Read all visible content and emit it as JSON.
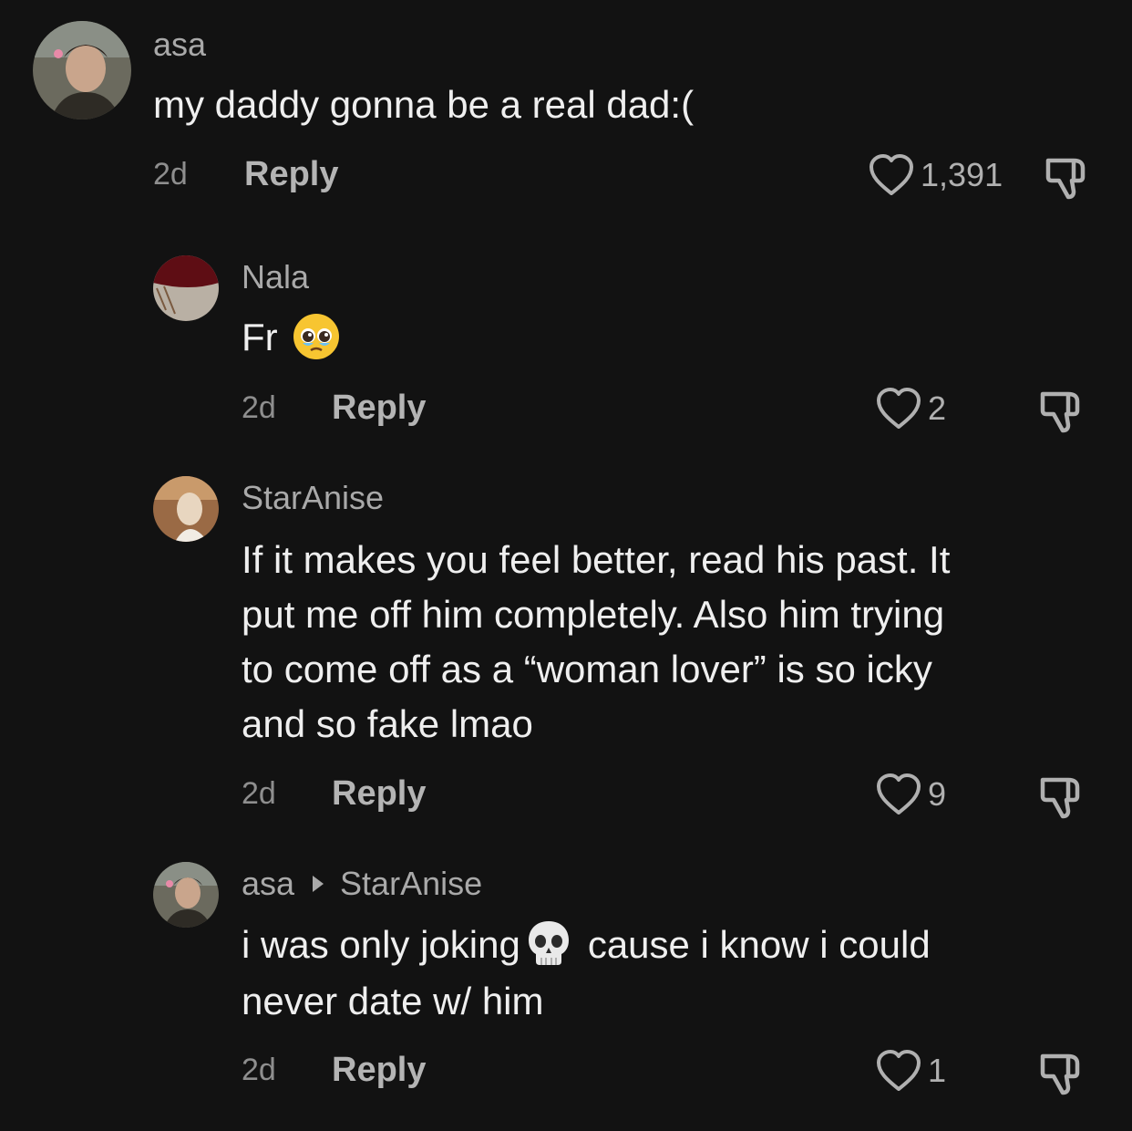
{
  "comments": [
    {
      "author": "asa",
      "text_lines": [
        "my daddy gonna be a real dad:("
      ],
      "age": "2d",
      "reply_label": "Reply",
      "likes": "1,391"
    },
    {
      "author": "Nala",
      "text": "Fr",
      "emoji": "pleading-face-emoji",
      "age": "2d",
      "reply_label": "Reply",
      "likes": "2"
    },
    {
      "author": "StarAnise",
      "text_lines": [
        "If it makes you feel better, read his past. It",
        "put me off him completely. Also him trying",
        "to come off as a “woman lover” is so icky",
        "and so fake lmao"
      ],
      "age": "2d",
      "reply_label": "Reply",
      "likes": "9"
    },
    {
      "author": "asa",
      "reply_to": "StarAnise",
      "text_before_emoji": "i was only joking",
      "emoji": "skull-emoji",
      "text_after_emoji": "cause i know i could",
      "text_line2": "never date w/ him",
      "age": "2d",
      "reply_label": "Reply",
      "likes": "1"
    }
  ],
  "colors": {
    "background": "#121212",
    "text": "#efefef",
    "secondary": "#a9a9a9"
  }
}
